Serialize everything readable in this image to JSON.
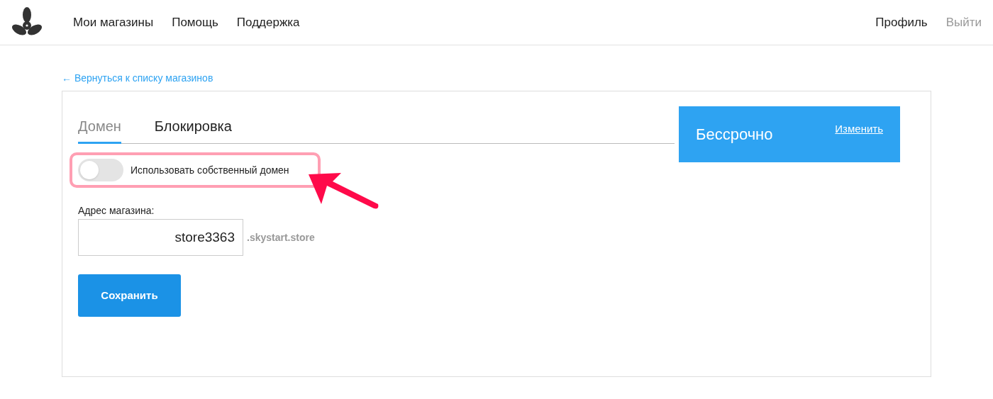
{
  "nav": {
    "items": [
      "Мои магазины",
      "Помощь",
      "Поддержка"
    ],
    "right": [
      {
        "label": "Профиль",
        "muted": false
      },
      {
        "label": "Выйти",
        "muted": true
      }
    ]
  },
  "back_link": "← Вернуться к списку магазинов",
  "tabs": [
    {
      "label": "Домен",
      "selected": true
    },
    {
      "label": "Блокировка",
      "selected": false
    }
  ],
  "toggle": {
    "label": "Использовать собственный домен",
    "on": false
  },
  "address": {
    "label": "Адрес магазина:",
    "value": "store3363",
    "suffix": ".skystart.store"
  },
  "save_button": "Сохранить",
  "plan": {
    "title": "Бессрочно",
    "link": "Изменить"
  }
}
